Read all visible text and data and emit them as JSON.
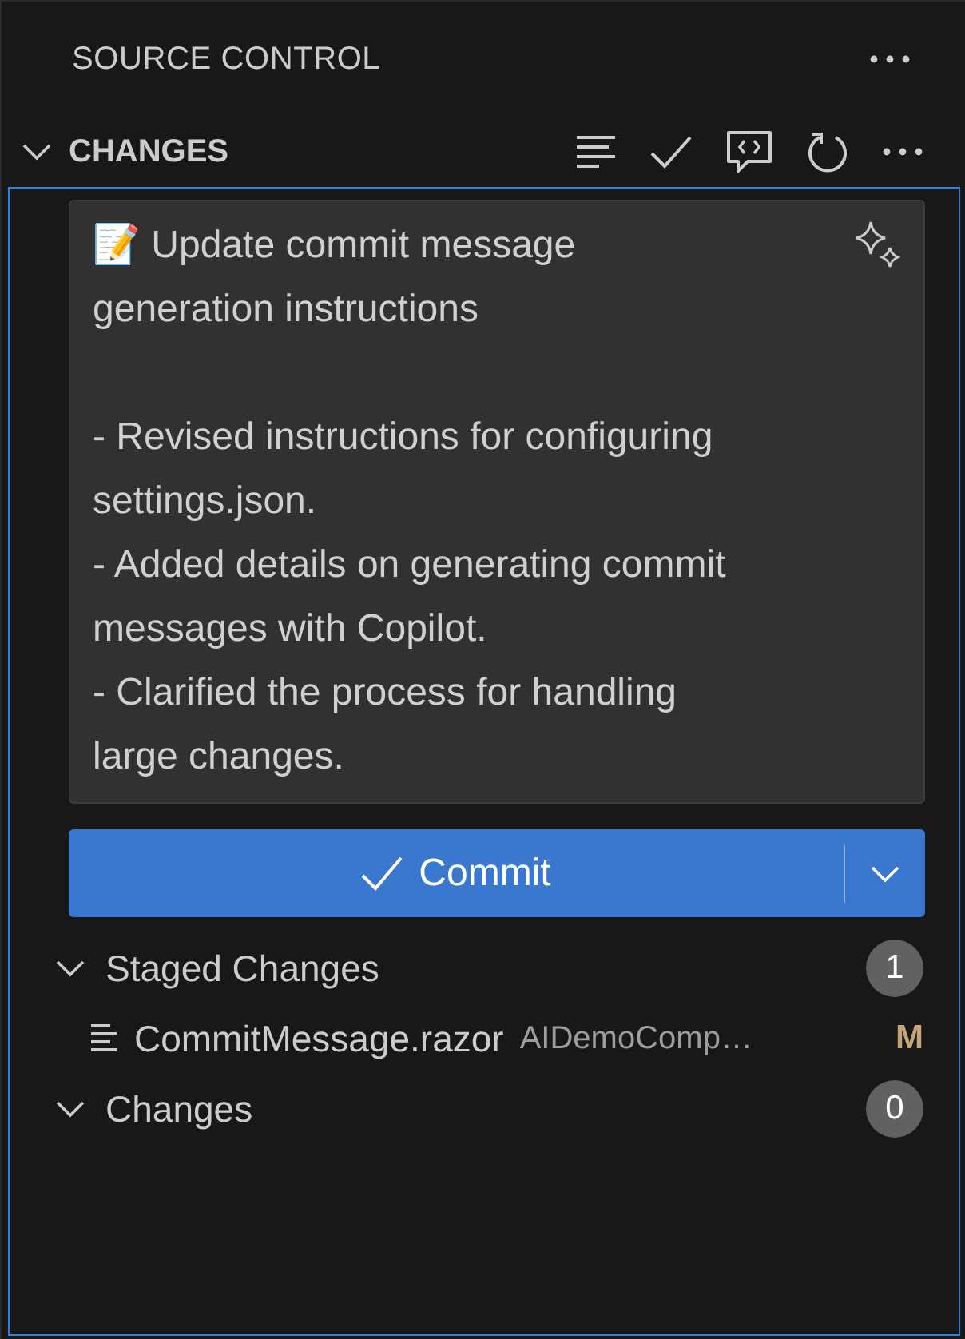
{
  "view_title": "SOURCE CONTROL",
  "section": {
    "title": "CHANGES",
    "expanded": true
  },
  "commit_message": {
    "value": "📝 Update commit message generation instructions\n\n- Revised instructions for configuring settings.json.\n- Added details on generating commit messages with Copilot.\n- Clarified the process for handling large changes."
  },
  "commit_button": {
    "label": "Commit"
  },
  "groups": [
    {
      "label": "Staged Changes",
      "count": "1",
      "expanded": true,
      "files": [
        {
          "name": "CommitMessage.razor",
          "path": "AIDemoComp…",
          "status": "M",
          "color": "#c3a77a"
        }
      ]
    },
    {
      "label": "Changes",
      "count": "0",
      "expanded": true
    }
  ]
}
